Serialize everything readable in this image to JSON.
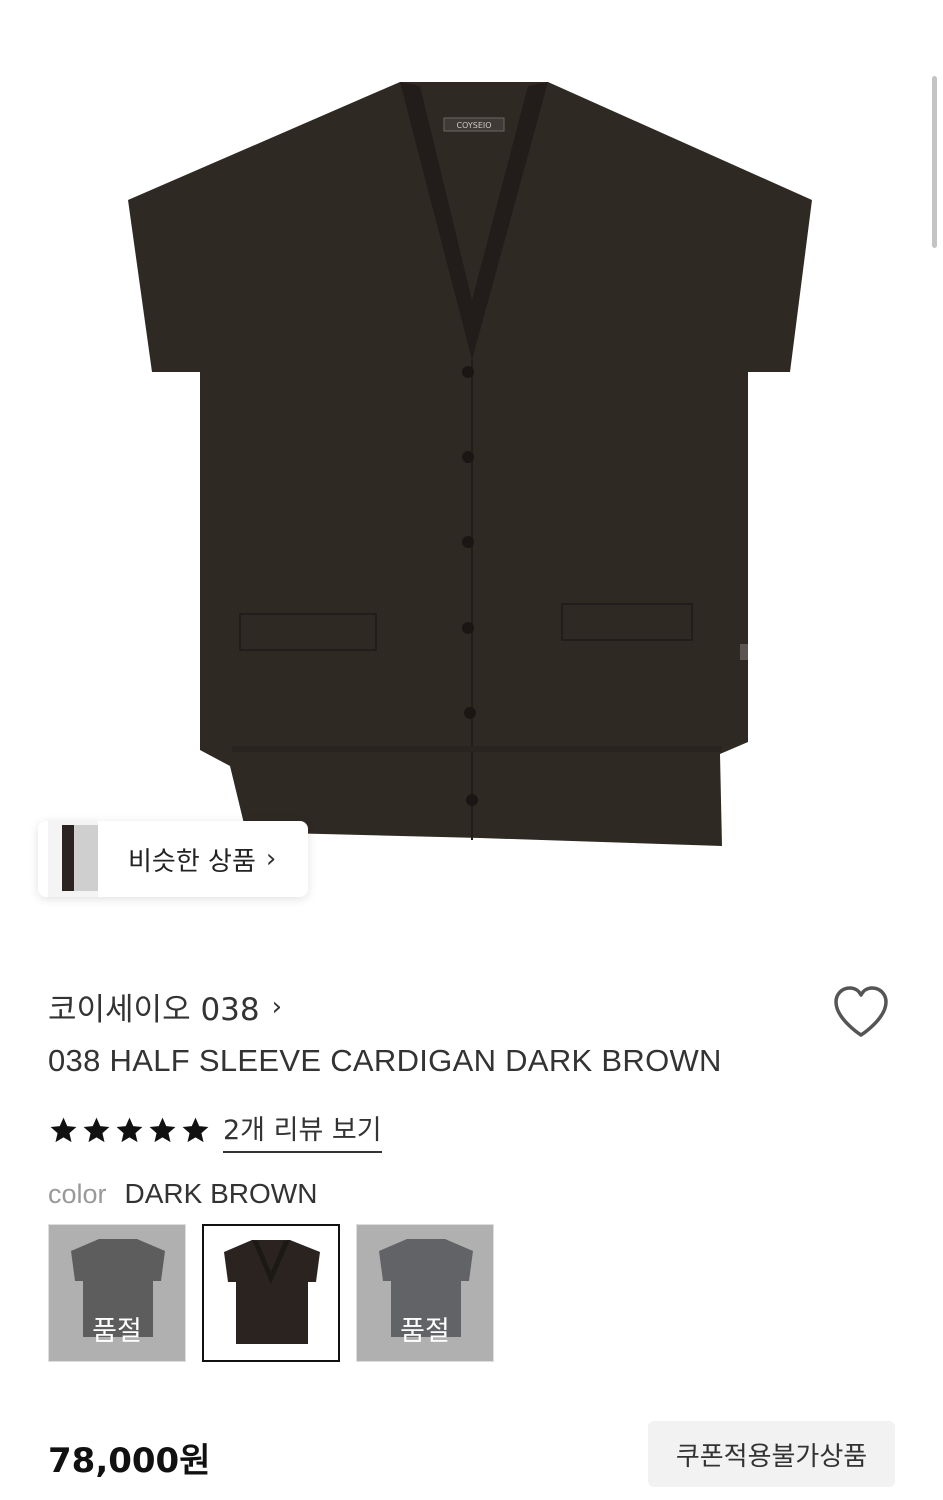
{
  "product_image": {
    "alt": "038 HALF SLEEVE CARDIGAN DARK BROWN",
    "logo_text": "COYSEIO",
    "garment_color": "#2f2924"
  },
  "similar": {
    "label": "비슷한 상품",
    "chevron": "›"
  },
  "brand": {
    "name": "코이세이오 038",
    "chevron": "›"
  },
  "product": {
    "title": "038 HALF SLEEVE CARDIGAN DARK BROWN",
    "rating_stars": 5,
    "review_link": "2개 리뷰 보기"
  },
  "color": {
    "label": "color",
    "selected": "DARK BROWN",
    "options": [
      {
        "garment_color": "#3c3c3c",
        "sold_out": true,
        "sold_out_label": "품절"
      },
      {
        "garment_color": "#2a2320",
        "sold_out": false
      },
      {
        "garment_color": "#454a52",
        "sold_out": true,
        "sold_out_label": "품절"
      }
    ]
  },
  "price": "78,000원",
  "coupon_badge": "쿠폰적용불가상품",
  "colors": {
    "accent": "#111111",
    "muted": "#999999"
  }
}
